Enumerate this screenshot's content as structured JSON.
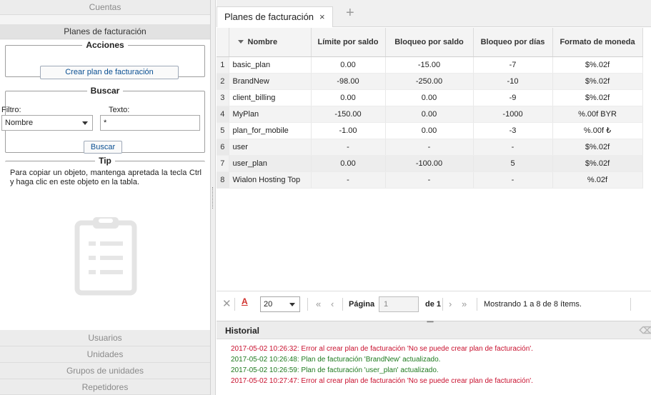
{
  "left": {
    "sections_top": [
      "Cuentas",
      "Planes de facturación"
    ],
    "sections_bottom": [
      "Usuarios",
      "Unidades",
      "Grupos de unidades",
      "Repetidores"
    ],
    "actions": {
      "title": "Acciones",
      "create_button": "Crear plan de facturación"
    },
    "search": {
      "title": "Buscar",
      "filter_label": "Filtro:",
      "text_label": "Texto:",
      "filter_value": "Nombre",
      "text_value": "*",
      "search_button": "Buscar"
    },
    "tip": {
      "title": "Tip",
      "text": "Para copiar un objeto, mantenga apretada la tecla Ctrl y haga clic en este objeto en la tabla."
    }
  },
  "tabs": [
    {
      "label": "Planes de facturación",
      "close": "×"
    }
  ],
  "add_tab_glyph": "+",
  "table": {
    "columns": [
      "Nombre",
      "Límite por saldo",
      "Bloqueo por saldo",
      "Bloqueo por días",
      "Formato de moneda"
    ],
    "rows": [
      [
        "1",
        "basic_plan",
        "0.00",
        "-15.00",
        "-7",
        "$%.02f"
      ],
      [
        "2",
        "BrandNew",
        "-98.00",
        "-250.00",
        "-10",
        "$%.02f"
      ],
      [
        "3",
        "client_billing",
        "0.00",
        "0.00",
        "-9",
        "$%.02f"
      ],
      [
        "4",
        "MyPlan",
        "-150.00",
        "0.00",
        "-1000",
        "%.00f BYR"
      ],
      [
        "5",
        "plan_for_mobile",
        "-1.00",
        "0.00",
        "-3",
        "%.00f ₺"
      ],
      [
        "6",
        "user",
        "-",
        "-",
        "-",
        "$%.02f"
      ],
      [
        "7",
        "user_plan",
        "0.00",
        "-100.00",
        "5",
        "$%.02f"
      ],
      [
        "8",
        "Wialon Hosting Top",
        "-",
        "-",
        "-",
        "%.02f"
      ]
    ]
  },
  "pager": {
    "page_size": "20",
    "page_label": "Página",
    "page_value": "1",
    "of_label": "de 1",
    "status": "Mostrando 1 a 8 de 8 ítems."
  },
  "history": {
    "title": "Historial",
    "entries": [
      {
        "text": "2017-05-02 10:26:32: Error al crear plan de facturación 'No se puede crear plan de facturación'.",
        "kind": "error"
      },
      {
        "text": "2017-05-02 10:26:48: Plan de facturación 'BrandNew' actualizado.",
        "kind": "ok"
      },
      {
        "text": "2017-05-02 10:26:59: Plan de facturación 'user_plan' actualizado.",
        "kind": "ok"
      },
      {
        "text": "2017-05-02 10:27:47: Error al crear plan de facturación 'No se puede crear plan de facturación'.",
        "kind": "error"
      }
    ]
  },
  "colors": {
    "error": "#c8102e",
    "ok": "#1f7a1f",
    "link": "#0a4f92"
  }
}
